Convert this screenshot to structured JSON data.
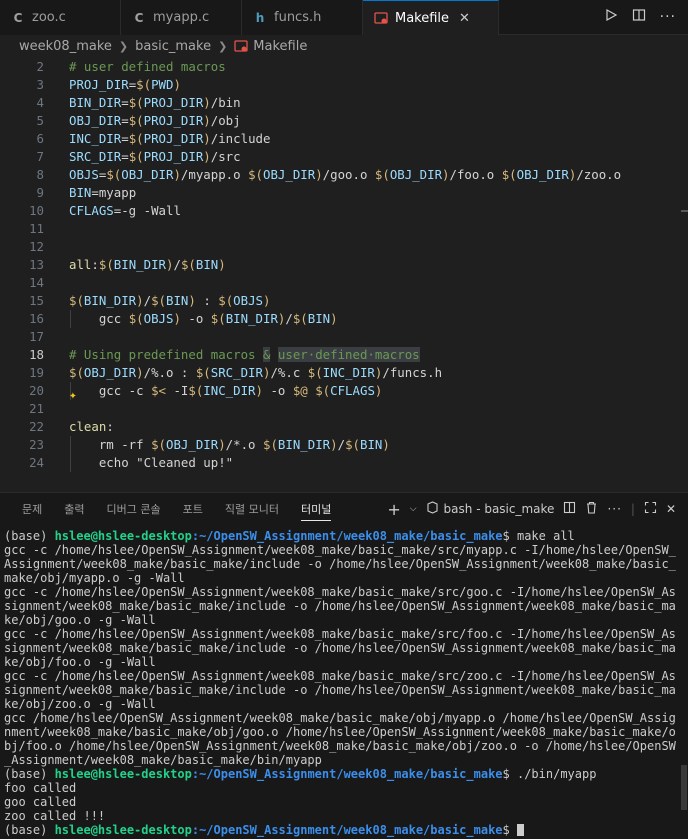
{
  "tabs": [
    {
      "label": "zoo.c",
      "icon": "C",
      "icon_color": "#a0a0a0",
      "active": false
    },
    {
      "label": "myapp.c",
      "icon": "C",
      "icon_color": "#a0a0a0",
      "active": false
    },
    {
      "label": "funcs.h",
      "icon": "h",
      "icon_color": "#519aba",
      "active": false
    },
    {
      "label": "Makefile",
      "icon": "makefile",
      "icon_color": "#e37933",
      "active": true
    }
  ],
  "tab_actions": [
    "run-icon",
    "split-editor-icon",
    "more-icon"
  ],
  "breadcrumb": [
    "week08_make",
    "basic_make",
    "Makefile"
  ],
  "editor": {
    "current_line": 18,
    "lines": [
      {
        "n": "2",
        "html": "<span class=\"c-com\"># user defined macros</span>"
      },
      {
        "n": "3",
        "html": "<span class=\"c-var\">PROJ_DIR</span>=<span class=\"c-d\">$(</span><span class=\"c-var\">PWD</span><span class=\"c-d\">)</span>"
      },
      {
        "n": "4",
        "html": "<span class=\"c-var\">BIN_DIR</span>=<span class=\"c-d\">$(</span><span class=\"c-var\">PROJ_DIR</span><span class=\"c-d\">)</span>/bin"
      },
      {
        "n": "5",
        "html": "<span class=\"c-var\">OBJ_DIR</span>=<span class=\"c-d\">$(</span><span class=\"c-var\">PROJ_DIR</span><span class=\"c-d\">)</span>/obj"
      },
      {
        "n": "6",
        "html": "<span class=\"c-var\">INC_DIR</span>=<span class=\"c-d\">$(</span><span class=\"c-var\">PROJ_DIR</span><span class=\"c-d\">)</span>/include"
      },
      {
        "n": "7",
        "html": "<span class=\"c-var\">SRC_DIR</span>=<span class=\"c-d\">$(</span><span class=\"c-var\">PROJ_DIR</span><span class=\"c-d\">)</span>/src"
      },
      {
        "n": "8",
        "html": "<span class=\"c-var\">OBJS</span>=<span class=\"c-d\">$(</span><span class=\"c-var\">OBJ_DIR</span><span class=\"c-d\">)</span>/myapp.o <span class=\"c-d\">$(</span><span class=\"c-var\">OBJ_DIR</span><span class=\"c-d\">)</span>/goo.o <span class=\"c-d\">$(</span><span class=\"c-var\">OBJ_DIR</span><span class=\"c-d\">)</span>/foo.o <span class=\"c-d\">$(</span><span class=\"c-var\">OBJ_DIR</span><span class=\"c-d\">)</span>/zoo.o"
      },
      {
        "n": "9",
        "html": "<span class=\"c-var\">BIN</span>=myapp"
      },
      {
        "n": "10",
        "html": "<span class=\"c-var\">CFLAGS</span>=-g -Wall"
      },
      {
        "n": "11",
        "html": ""
      },
      {
        "n": "12",
        "html": ""
      },
      {
        "n": "13",
        "html": "<span class=\"c-tgt\">all</span>:<span class=\"c-d\">$(</span><span class=\"c-var\">BIN_DIR</span><span class=\"c-d\">)</span>/<span class=\"c-d\">$(</span><span class=\"c-var\">BIN</span><span class=\"c-d\">)</span>"
      },
      {
        "n": "14",
        "html": ""
      },
      {
        "n": "15",
        "html": "<span class=\"c-d\">$(</span><span class=\"c-var\">BIN_DIR</span><span class=\"c-d\">)</span>/<span class=\"c-d\">$(</span><span class=\"c-var\">BIN</span><span class=\"c-d\">)</span> : <span class=\"c-d\">$(</span><span class=\"c-var\">OBJS</span><span class=\"c-d\">)</span>"
      },
      {
        "n": "16",
        "html": "    gcc <span class=\"c-d\">$(</span><span class=\"c-var\">OBJS</span><span class=\"c-d\">)</span> -o <span class=\"c-d\">$(</span><span class=\"c-var\">BIN_DIR</span><span class=\"c-d\">)</span>/<span class=\"c-d\">$(</span><span class=\"c-var\">BIN</span><span class=\"c-d\">)</span>"
      },
      {
        "n": "17",
        "html": ""
      },
      {
        "n": "18",
        "html": "<span class=\"c-com\"># Using predefined macros <span class=\"hl\">&amp;</span> <span class=\"hl\">user·defined·macros</span></span>"
      },
      {
        "n": "19",
        "html": "<span class=\"c-d\">$(</span><span class=\"c-var\">OBJ_DIR</span><span class=\"c-d\">)</span>/%.o : <span class=\"c-d\">$(</span><span class=\"c-var\">SRC_DIR</span><span class=\"c-d\">)</span>/%.c <span class=\"c-d\">$(</span><span class=\"c-var\">INC_DIR</span><span class=\"c-d\">)</span>/funcs.h"
      },
      {
        "n": "20",
        "html": "    gcc -c <span class=\"c-d\">$&lt;</span> -I<span class=\"c-d\">$(</span><span class=\"c-var\">INC_DIR</span><span class=\"c-d\">)</span> -o <span class=\"c-d\">$@</span> <span class=\"c-d\">$(</span><span class=\"c-var\">CFLAGS</span><span class=\"c-d\">)</span>"
      },
      {
        "n": "21",
        "html": ""
      },
      {
        "n": "22",
        "html": "<span class=\"c-tgt\">clean</span>:"
      },
      {
        "n": "23",
        "html": "    rm -rf <span class=\"c-d\">$(</span><span class=\"c-var\">OBJ_DIR</span><span class=\"c-d\">)</span>/*.o <span class=\"c-d\">$(</span><span class=\"c-var\">BIN_DIR</span><span class=\"c-d\">)</span>/<span class=\"c-d\">$(</span><span class=\"c-var\">BIN</span><span class=\"c-d\">)</span>"
      },
      {
        "n": "24",
        "html": "    echo \"Cleaned up!\""
      }
    ]
  },
  "panel": {
    "tabs": [
      "문제",
      "출력",
      "디버그 콘솔",
      "포트",
      "직렬 모니터",
      "터미널"
    ],
    "active_tab": "터미널",
    "shell_label": "bash - basic_make"
  },
  "terminal": {
    "prompt_env": "(base) ",
    "prompt_user": "hslee@hslee-desktop",
    "prompt_path": ":~/OpenSW_Assignment/week08_make/basic_make",
    "lines": [
      {
        "type": "prompt",
        "cmd": "$ make all"
      },
      {
        "type": "out",
        "text": "gcc -c /home/hslee/OpenSW_Assignment/week08_make/basic_make/src/myapp.c -I/home/hslee/OpenSW_"
      },
      {
        "type": "out",
        "text": "Assignment/week08_make/basic_make/include -o /home/hslee/OpenSW_Assignment/week08_make/basic_"
      },
      {
        "type": "out",
        "text": "make/obj/myapp.o -g -Wall"
      },
      {
        "type": "out",
        "text": "gcc -c /home/hslee/OpenSW_Assignment/week08_make/basic_make/src/goo.c -I/home/hslee/OpenSW_As"
      },
      {
        "type": "out",
        "text": "signment/week08_make/basic_make/include -o /home/hslee/OpenSW_Assignment/week08_make/basic_ma"
      },
      {
        "type": "out",
        "text": "ke/obj/goo.o -g -Wall"
      },
      {
        "type": "out",
        "text": "gcc -c /home/hslee/OpenSW_Assignment/week08_make/basic_make/src/foo.c -I/home/hslee/OpenSW_As"
      },
      {
        "type": "out",
        "text": "signment/week08_make/basic_make/include -o /home/hslee/OpenSW_Assignment/week08_make/basic_ma"
      },
      {
        "type": "out",
        "text": "ke/obj/foo.o -g -Wall"
      },
      {
        "type": "out",
        "text": "gcc -c /home/hslee/OpenSW_Assignment/week08_make/basic_make/src/zoo.c -I/home/hslee/OpenSW_As"
      },
      {
        "type": "out",
        "text": "signment/week08_make/basic_make/include -o /home/hslee/OpenSW_Assignment/week08_make/basic_ma"
      },
      {
        "type": "out",
        "text": "ke/obj/zoo.o -g -Wall"
      },
      {
        "type": "out",
        "text": "gcc /home/hslee/OpenSW_Assignment/week08_make/basic_make/obj/myapp.o /home/hslee/OpenSW_Assig"
      },
      {
        "type": "out",
        "text": "nment/week08_make/basic_make/obj/goo.o /home/hslee/OpenSW_Assignment/week08_make/basic_make/o"
      },
      {
        "type": "out",
        "text": "bj/foo.o /home/hslee/OpenSW_Assignment/week08_make/basic_make/obj/zoo.o -o /home/hslee/OpenSW"
      },
      {
        "type": "out",
        "text": "_Assignment/week08_make/basic_make/bin/myapp"
      },
      {
        "type": "prompt",
        "cmd": "$ ./bin/myapp"
      },
      {
        "type": "out",
        "text": "foo called"
      },
      {
        "type": "out",
        "text": "goo called"
      },
      {
        "type": "out",
        "text": "zoo called !!!"
      },
      {
        "type": "prompt",
        "cmd": "$ ",
        "cursor": true
      }
    ]
  },
  "colors": {
    "accent": "#0078d4",
    "prompt_user": "#23d18b",
    "prompt_path": "#3b8eea"
  }
}
